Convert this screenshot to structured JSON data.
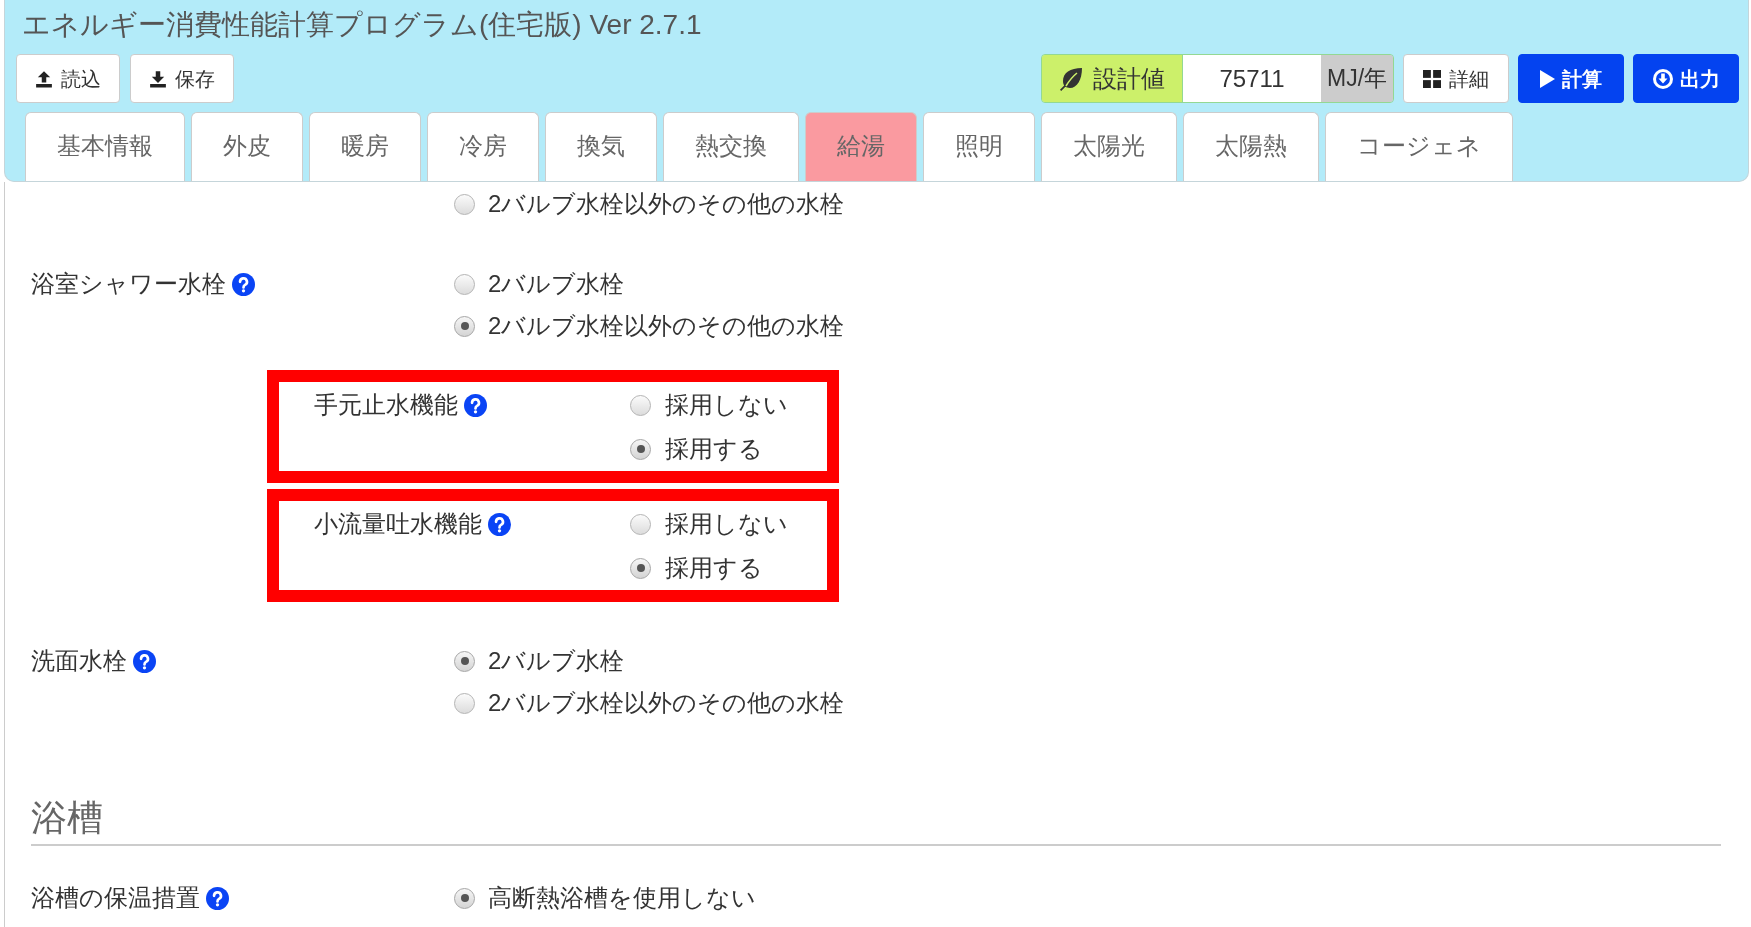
{
  "window": {
    "title": "エネルギー消費性能計算プログラム(住宅版) Ver 2.7.1"
  },
  "file_buttons": [
    {
      "label": "読込"
    },
    {
      "label": "保存"
    }
  ],
  "result": {
    "label": "設計値",
    "value": "75711",
    "unit": "MJ/年"
  },
  "action_buttons": [
    {
      "label": "詳細",
      "kind": "default"
    },
    {
      "label": "計算",
      "kind": "primary"
    },
    {
      "label": "出力",
      "kind": "primary"
    }
  ],
  "tabs": [
    {
      "label": "基本情報",
      "selected": false
    },
    {
      "label": "外皮",
      "selected": false
    },
    {
      "label": "暖房",
      "selected": false
    },
    {
      "label": "冷房",
      "selected": false
    },
    {
      "label": "換気",
      "selected": false
    },
    {
      "label": "熱交換",
      "selected": false
    },
    {
      "label": "給湯",
      "selected": true
    },
    {
      "label": "照明",
      "selected": false
    },
    {
      "label": "太陽光",
      "selected": false
    },
    {
      "label": "太陽熱",
      "selected": false
    },
    {
      "label": "コージェネ",
      "selected": false
    }
  ],
  "form": {
    "rows": [
      {
        "options": [
          {
            "label": "2バルブ水栓以外のその他の水栓",
            "selected": false
          }
        ]
      },
      {
        "label": "浴室シャワー水栓",
        "options": [
          {
            "label": "2バルブ水栓",
            "selected": false
          },
          {
            "label": "2バルブ水栓以外のその他の水栓",
            "selected": true
          }
        ],
        "sub_settings": [
          {
            "label": "手元止水機能",
            "highlighted": true,
            "options": [
              {
                "label": "採用しない",
                "selected": false
              },
              {
                "label": "採用する",
                "selected": true
              }
            ]
          },
          {
            "label": "小流量吐水機能",
            "highlighted": true,
            "options": [
              {
                "label": "採用しない",
                "selected": false
              },
              {
                "label": "採用する",
                "selected": true
              }
            ]
          }
        ]
      },
      {
        "label": "洗面水栓",
        "options": [
          {
            "label": "2バルブ水栓",
            "selected": true
          },
          {
            "label": "2バルブ水栓以外のその他の水栓",
            "selected": false
          }
        ]
      }
    ]
  },
  "sections": [
    {
      "heading": "浴槽",
      "rows": [
        {
          "label": "浴槽の保温措置",
          "options": [
            {
              "label": "高断熱浴槽を使用しない",
              "selected": true
            }
          ]
        }
      ]
    }
  ]
}
